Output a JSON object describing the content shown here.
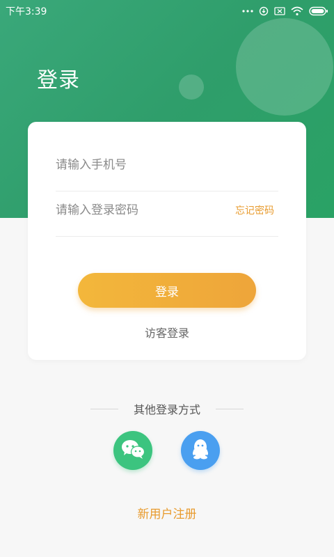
{
  "status_bar": {
    "time": "下午3:39"
  },
  "header": {
    "title": "登录"
  },
  "form": {
    "phone_placeholder": "请输入手机号",
    "password_placeholder": "请输入登录密码",
    "forgot_label": "忘记密码",
    "login_label": "登录",
    "guest_label": "访客登录"
  },
  "other_login": {
    "label": "其他登录方式",
    "methods": [
      {
        "icon": "wechat-icon",
        "color": "#3cc47f"
      },
      {
        "icon": "qq-icon",
        "color": "#4a9ff0"
      }
    ]
  },
  "register_label": "新用户注册",
  "colors": {
    "brand_green": "#2f9e6b",
    "accent_orange": "#eea53a"
  }
}
